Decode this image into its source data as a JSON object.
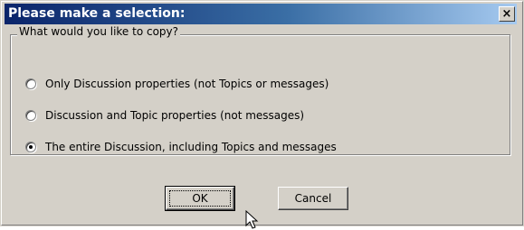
{
  "dialog": {
    "title": "Please make a selection:",
    "close_glyph": "×"
  },
  "group": {
    "legend": "What would you like to copy?",
    "options": [
      {
        "label": "Only Discussion properties (not Topics or messages)",
        "checked": false
      },
      {
        "label": "Discussion and Topic properties (not messages)",
        "checked": false
      },
      {
        "label": "The entire Discussion, including Topics and messages",
        "checked": true
      }
    ]
  },
  "buttons": {
    "ok_label": "OK",
    "cancel_label": "Cancel"
  },
  "icons": {
    "close": "close-icon",
    "cursor": "mouse-pointer-icon"
  },
  "colors": {
    "titlebar_start": "#0a246a",
    "titlebar_end": "#a6caf0",
    "face": "#d4d0c8"
  }
}
